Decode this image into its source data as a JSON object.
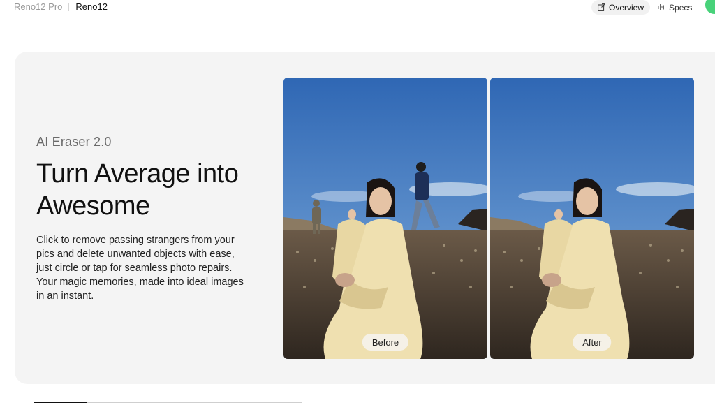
{
  "nav": {
    "model_prev": "Reno12 Pro",
    "model_current": "Reno12",
    "tabs": [
      {
        "label": "Overview",
        "icon": "overview-icon",
        "active": true
      },
      {
        "label": "Specs",
        "icon": "specs-icon",
        "active": false
      }
    ]
  },
  "feature": {
    "eyebrow": "AI Eraser 2.0",
    "headline": "Turn Average into Awesome",
    "description": "Click to remove passing strangers from your pics and delete unwanted objects with ease, just circle or tap for seamless photo repairs. Your magic memories, made into ideal images in an instant."
  },
  "comparison": {
    "before_label": "Before",
    "after_label": "After"
  },
  "carousel": {
    "progress": 0.2
  },
  "colors": {
    "accent_green": "#48d27a",
    "card_bg": "#f4f4f4",
    "sky_top": "#2f67b4",
    "sky_bottom": "#a9c7e3",
    "dress": "#efe0b0"
  }
}
